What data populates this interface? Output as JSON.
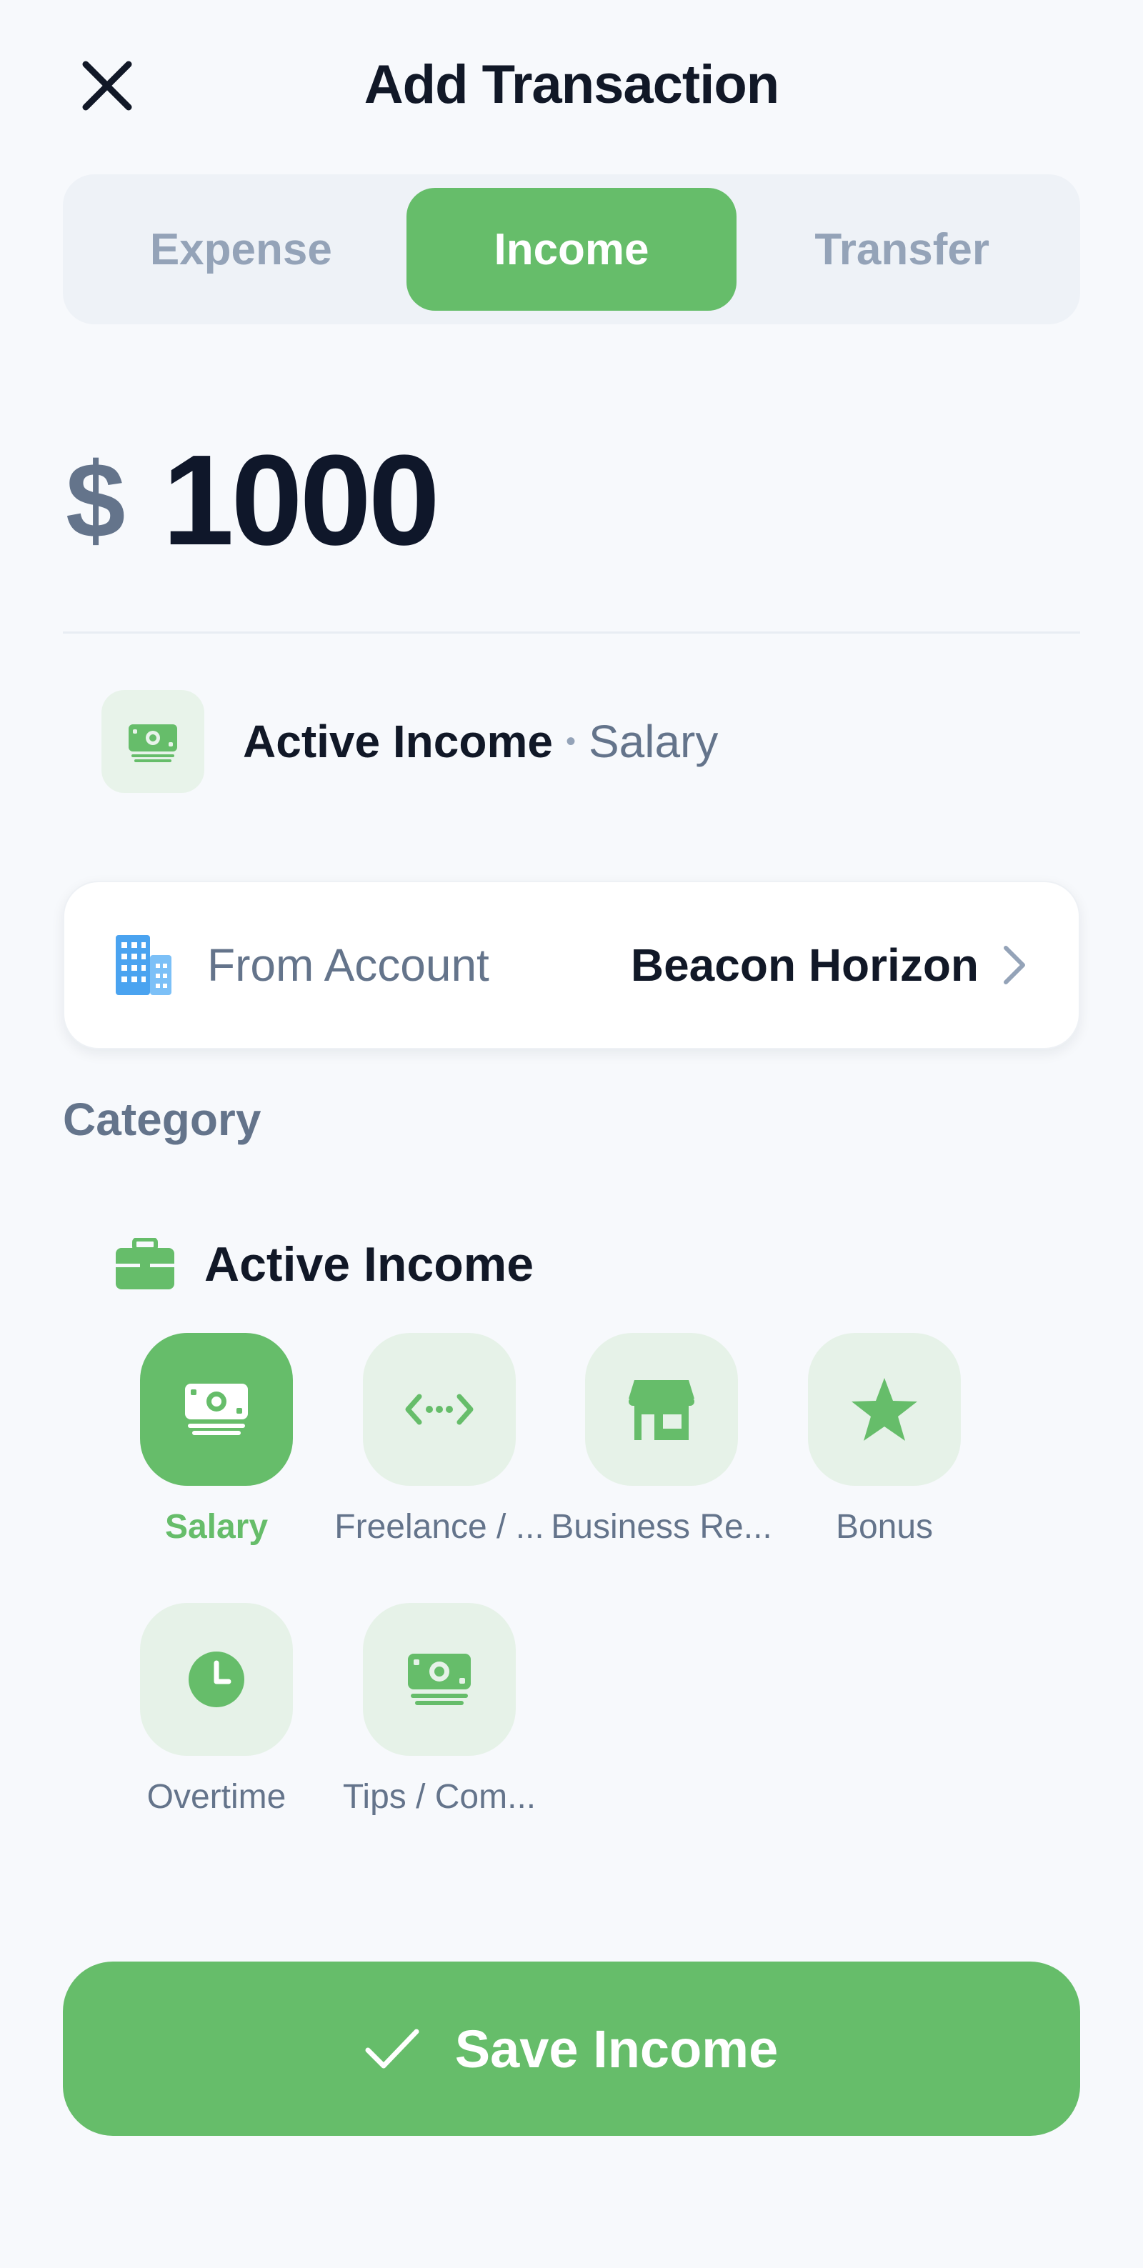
{
  "header": {
    "title": "Add Transaction",
    "close_icon": "close-icon"
  },
  "tabs": [
    {
      "label": "Expense",
      "active": false
    },
    {
      "label": "Income",
      "active": true
    },
    {
      "label": "Transfer",
      "active": false
    }
  ],
  "amount": {
    "currency": "$",
    "value": "1000"
  },
  "selected_category": {
    "group": "Active Income",
    "separator": "•",
    "name": "Salary",
    "icon": "money-icon"
  },
  "account": {
    "icon": "building-icon",
    "label": "From Account",
    "value": "Beacon Horizon",
    "chevron": "chevron-right-icon"
  },
  "category_section": {
    "label": "Category",
    "group": {
      "icon": "briefcase-icon",
      "title": "Active Income"
    },
    "items": [
      {
        "label": "Salary",
        "icon": "money-icon",
        "active": true
      },
      {
        "label": "Freelance / ...",
        "icon": "code-icon",
        "active": false
      },
      {
        "label": "Business Re...",
        "icon": "store-icon",
        "active": false
      },
      {
        "label": "Bonus",
        "icon": "star-icon",
        "active": false
      },
      {
        "label": "Overtime",
        "icon": "clock-icon",
        "active": false
      },
      {
        "label": "Tips / Com...",
        "icon": "money-icon",
        "active": false
      }
    ]
  },
  "save_button": {
    "label": "Save Income",
    "icon": "check-icon"
  },
  "colors": {
    "accent": "#66bd6a",
    "accent_light": "#e6f2e8",
    "text_primary": "#111827",
    "text_secondary": "#64748b",
    "background": "#f7f9fc"
  }
}
